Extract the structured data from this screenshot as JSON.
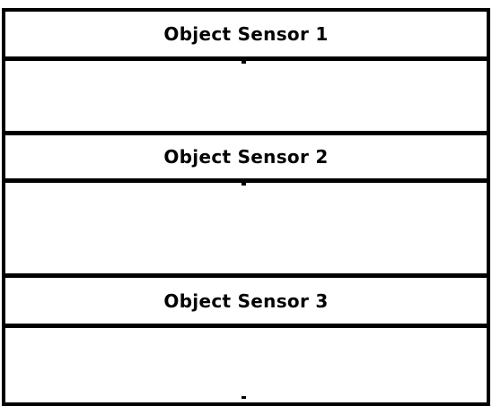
{
  "sections": [
    {
      "title": "Object Sensor 1"
    },
    {
      "title": "Object Sensor 2"
    },
    {
      "title": "Object Sensor 3"
    }
  ],
  "colors": {
    "background": "#ffffff",
    "line": "#000000",
    "text": "#000000"
  }
}
